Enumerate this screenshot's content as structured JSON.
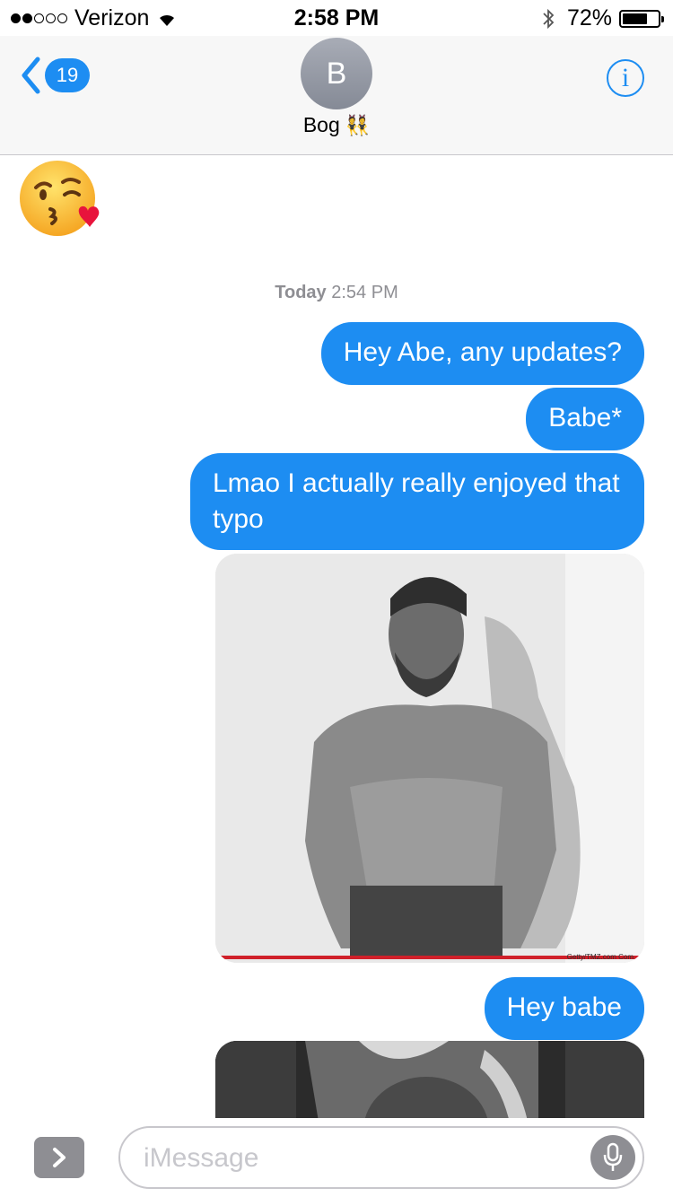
{
  "status_bar": {
    "carrier": "Verizon",
    "signal_bars": 2,
    "time": "2:58 PM",
    "battery": "72%",
    "battery_level": 0.72
  },
  "header": {
    "back_badge": "19",
    "avatar_initial": "B",
    "contact_name": "Bog",
    "contact_emoji": "👯",
    "info_label": "i"
  },
  "messages": {
    "incoming_emoji": "face-blowing-a-kiss",
    "timestamp_day": "Today",
    "timestamp_time": "2:54 PM",
    "outgoing": [
      "Hey Abe, any updates?",
      "Babe*",
      "Lmao I actually really enjoyed that typo",
      "Hey babe"
    ],
    "photo_credit": "Getty/TMZ.com Com"
  },
  "input_bar": {
    "placeholder": "iMessage",
    "value": ""
  },
  "colors": {
    "bubble_blue": "#1d8df2",
    "nav_bg": "#f7f7f7",
    "gray": "#8e8e93"
  }
}
